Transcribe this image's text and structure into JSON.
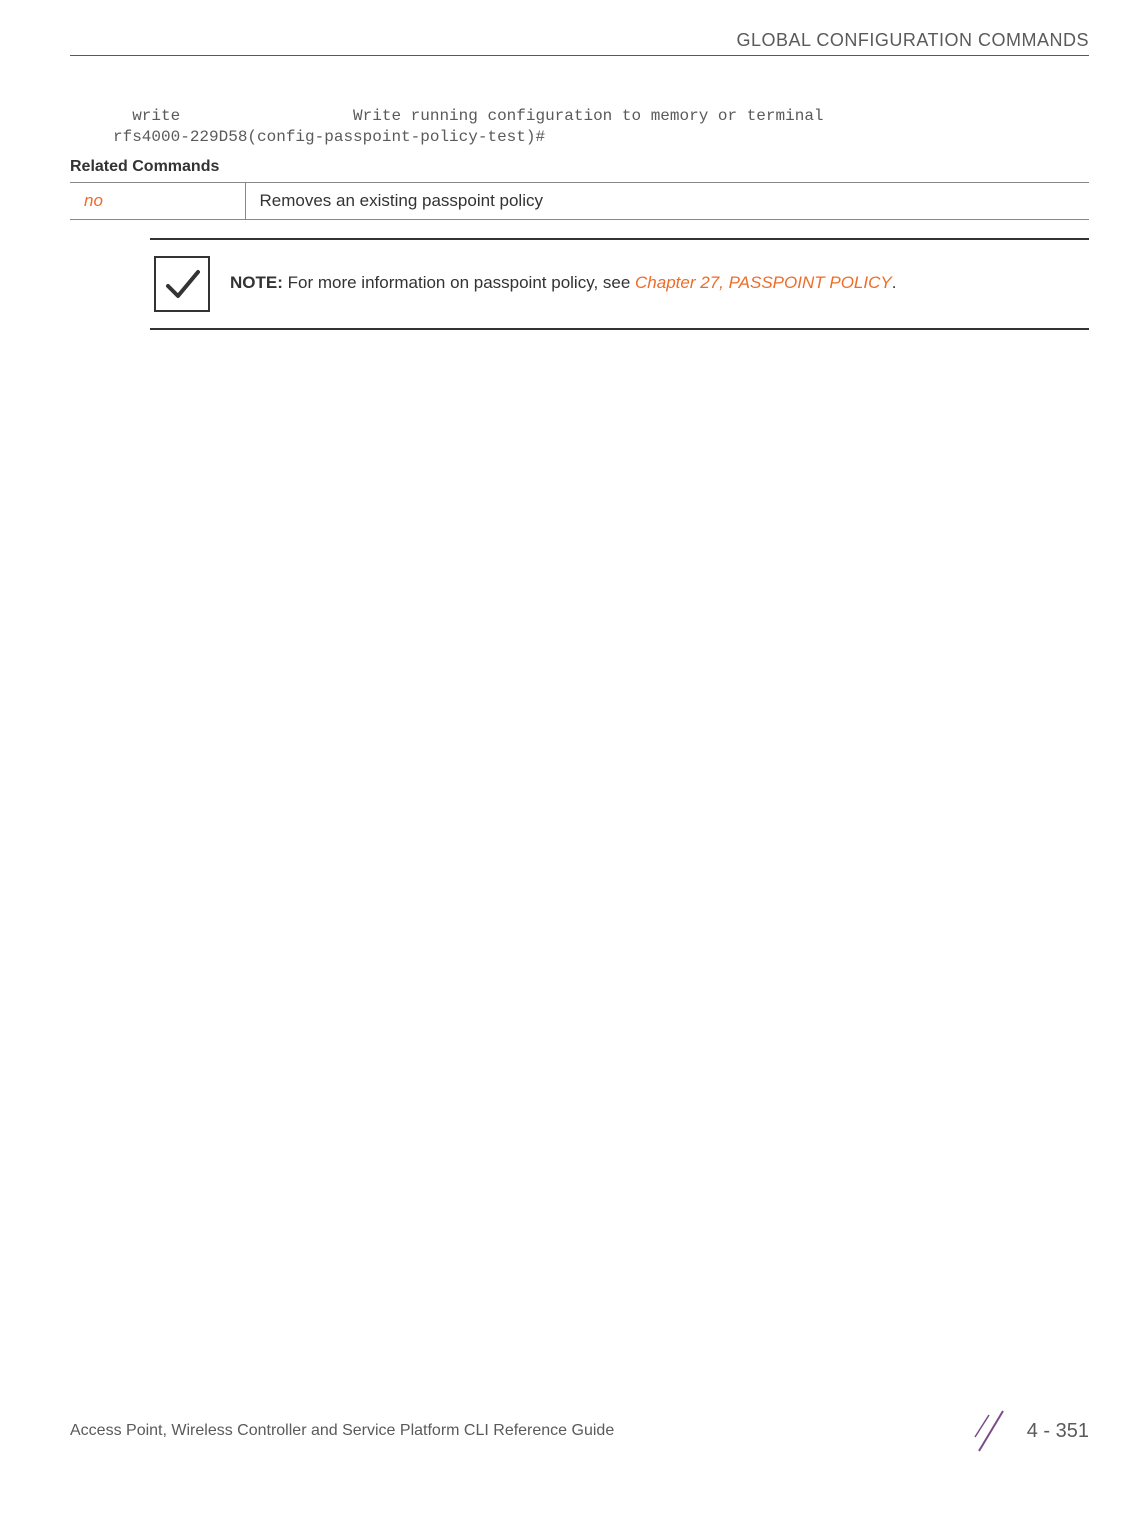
{
  "header": {
    "title": "GLOBAL CONFIGURATION COMMANDS"
  },
  "code": {
    "line1": "  write                  Write running configuration to memory or terminal",
    "line2": "rfs4000-229D58(config-passpoint-policy-test)#"
  },
  "related": {
    "title": "Related Commands",
    "rows": [
      {
        "cmd": "no",
        "desc": "Removes an existing passpoint policy"
      }
    ]
  },
  "note": {
    "label": "NOTE:",
    "text_before": " For more information on passpoint policy, see ",
    "link": "Chapter 27, PASSPOINT POLICY",
    "text_after": "."
  },
  "footer": {
    "guide": "Access Point, Wireless Controller and Service Platform CLI Reference Guide",
    "page": "4 - 351"
  }
}
